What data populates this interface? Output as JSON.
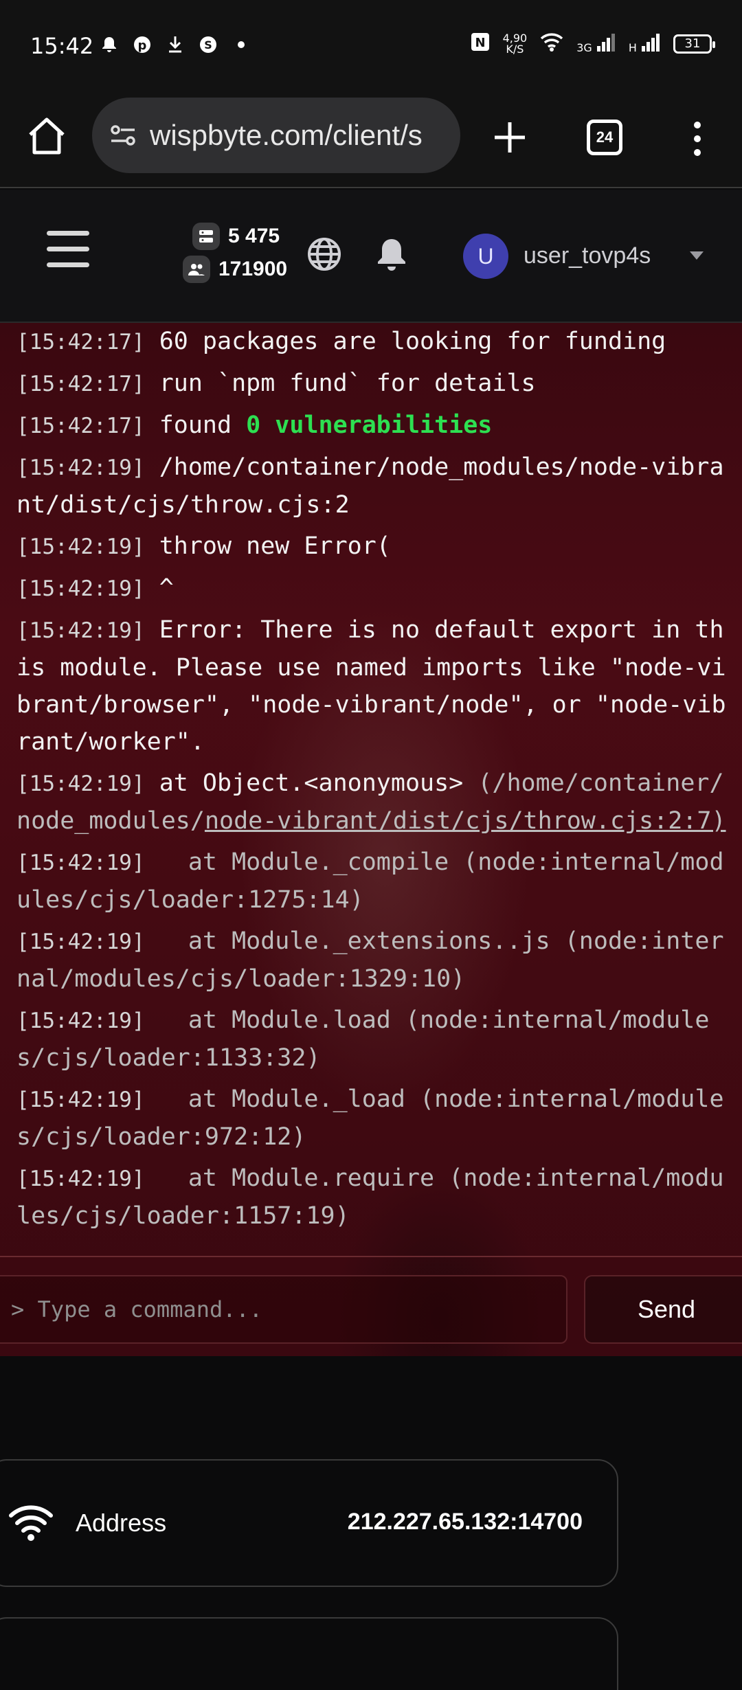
{
  "status_bar": {
    "time": "15:42",
    "net_speed_value": "4,90",
    "net_speed_unit": "K/S",
    "signal1_label": "3G",
    "signal2_label": "H",
    "battery": "31"
  },
  "browser": {
    "url": "wispbyte.com/client/s",
    "tab_count": "24"
  },
  "header": {
    "stat_servers": "5 475",
    "stat_users": "171900",
    "avatar_letter": "U",
    "username": "user_tovp4s"
  },
  "console": {
    "lines": [
      {
        "ts": "[15:42:17]",
        "text": "60 packages are looking for funding"
      },
      {
        "ts": "[15:42:17]",
        "text": "run `npm fund` for details"
      },
      {
        "ts": "[15:42:17]",
        "prefix": "found ",
        "highlight": "0 vulnerabilities"
      },
      {
        "ts": "[15:42:19]",
        "text": "/home/container/node_modules/node-vibrant/dist/cjs/throw.cjs:2"
      },
      {
        "ts": "[15:42:19]",
        "text": "throw new Error("
      },
      {
        "ts": "[15:42:19]",
        "text": "^"
      },
      {
        "ts": "[15:42:19]",
        "text": "Error: There is no default export in this module. Please use named imports like \"node-vibrant/browser\", \"node-vibrant/node\", or \"node-vibrant/worker\"."
      },
      {
        "ts": "[15:42:19]",
        "text": "at Object.<anonymous>",
        "dim_text": "(/home/container/node_modules/",
        "link": "node-vibrant/dist/cjs/throw.cjs:2:7)"
      },
      {
        "ts": "[15:42:19]",
        "dim": "  at Module._compile (node:internal/modules/cjs/loader:1275:14)"
      },
      {
        "ts": "[15:42:19]",
        "dim": "  at Module._extensions..js (node:internal/modules/cjs/loader:1329:10)"
      },
      {
        "ts": "[15:42:19]",
        "dim": "  at Module.load (node:internal/modules/cjs/loader:1133:32)"
      },
      {
        "ts": "[15:42:19]",
        "dim": "  at Module._load (node:internal/modules/cjs/loader:972:12)"
      },
      {
        "ts": "[15:42:19]",
        "dim": "  at Module.require (node:internal/modules/cjs/loader:1157:19)"
      }
    ],
    "input_placeholder": "> Type a command...",
    "send_label": "Send"
  },
  "address_card": {
    "label": "Address",
    "value": "212.227.65.132:14700"
  }
}
